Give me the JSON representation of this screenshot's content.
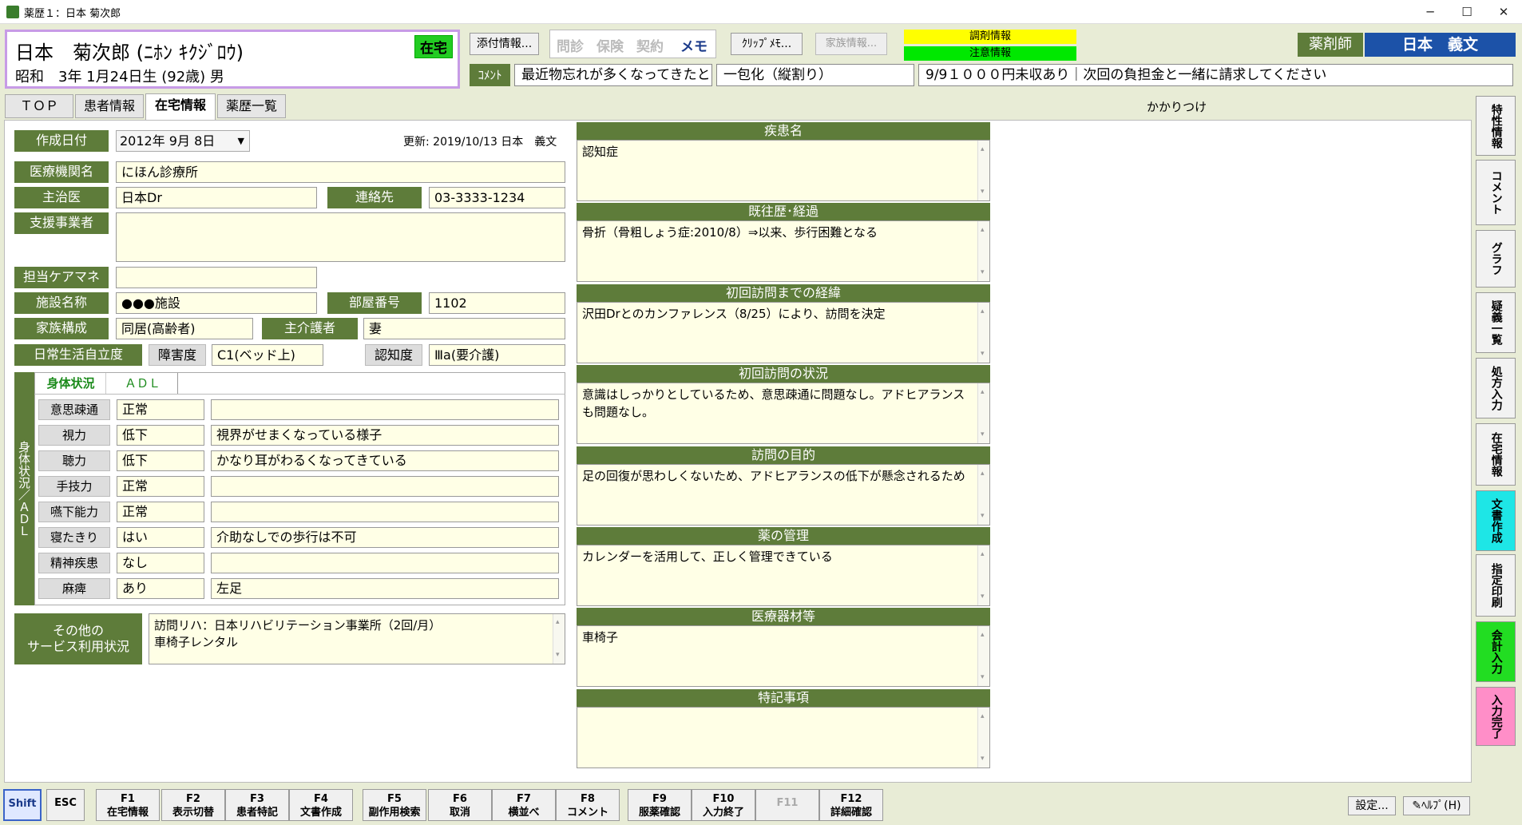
{
  "window": {
    "title": "薬歴１：日本 菊次郎",
    "minimize": "─",
    "maximize": "☐",
    "close": "✕"
  },
  "patient": {
    "name": "日本　菊次郎 (ﾆﾎﾝ ｷｸｼﾞﾛｳ)",
    "birth": "昭和　3年 1月24日生 (92歳) 男",
    "badge": "在宅"
  },
  "toolbar": {
    "attach": "添付情報...",
    "mon": "問診",
    "hoken": "保険",
    "keiyaku": "契約",
    "memo": "メモ",
    "clip": "ｸﾘｯﾌﾟﾒﾓ...",
    "family": "家族情報...",
    "chozai": "調剤情報",
    "chui": "注意情報",
    "role": "薬剤師",
    "pharmacist": "日本　義文",
    "comment_label": "ｺﾒﾝﾄ",
    "comment1": "最近物忘れが多くなってきたとの",
    "comment2": "一包化（縦割り）",
    "comment3": "9/9１０００円未収あり｜次回の負担金と一緒に請求してください"
  },
  "tabs": [
    "ＴＯＰ",
    "患者情報",
    "在宅情報",
    "薬歴一覧"
  ],
  "kakaritsuke": "かかりつけ",
  "form": {
    "created_label": "作成日付",
    "created": "2012年  9月  8日",
    "updated": "更新: 2019/10/13 日本　義文",
    "clinic_label": "医療機関名",
    "clinic": "にほん診療所",
    "doctor_label": "主治医",
    "doctor": "日本Dr",
    "contact_label": "連絡先",
    "contact": "03-3333-1234",
    "support_label": "支援事業者",
    "support": "",
    "caremgr_label": "担当ケアマネ",
    "caremgr": "",
    "facility_label": "施設名称",
    "facility": "●●●施設",
    "room_label": "部屋番号",
    "room": "1102",
    "family_label": "家族構成",
    "family": "同居(高齢者)",
    "caregiver_label": "主介護者",
    "caregiver": "妻",
    "adl_label": "日常生活自立度",
    "disability_label": "障害度",
    "disability": "C1(ベッド上)",
    "dementia_label": "認知度",
    "dementia": "Ⅲa(要介護)",
    "subtab1": "身体状況",
    "subtab2": "ＡＤＬ",
    "side_label": "身体状況／ＡＤＬ",
    "rows": [
      {
        "label": "意思疎通",
        "value": "正常",
        "note": ""
      },
      {
        "label": "視力",
        "value": "低下",
        "note": "視界がせまくなっている様子"
      },
      {
        "label": "聴力",
        "value": "低下",
        "note": "かなり耳がわるくなってきている"
      },
      {
        "label": "手技力",
        "value": "正常",
        "note": ""
      },
      {
        "label": "嚥下能力",
        "value": "正常",
        "note": ""
      },
      {
        "label": "寝たきり",
        "value": "はい",
        "note": "介助なしでの歩行は不可"
      },
      {
        "label": "精神疾患",
        "value": "なし",
        "note": ""
      },
      {
        "label": "麻痺",
        "value": "あり",
        "note": "左足"
      }
    ],
    "other_label1": "その他の",
    "other_label2": "サービス利用状況",
    "other1": "訪問リハ：日本リハビリテーション事業所（2回/月）",
    "other2": "車椅子レンタル"
  },
  "sections": [
    {
      "title": "疾患名",
      "body": "認知症"
    },
    {
      "title": "既往歴･経過",
      "body": "骨折（骨粗しょう症:2010/8）⇒以来、歩行困難となる"
    },
    {
      "title": "初回訪問までの経緯",
      "body": "沢田Drとのカンファレンス（8/25）により、訪問を決定"
    },
    {
      "title": "初回訪問の状況",
      "body": "意識はしっかりとしているため、意思疎通に問題なし。アドヒアランスも問題なし。"
    },
    {
      "title": "訪問の目的",
      "body": "足の回復が思わしくないため、アドヒアランスの低下が懸念されるため"
    },
    {
      "title": "薬の管理",
      "body": "カレンダーを活用して、正しく管理できている"
    },
    {
      "title": "医療器材等",
      "body": "車椅子"
    },
    {
      "title": "特記事項",
      "body": ""
    }
  ],
  "sidebar": [
    "特性情報",
    "コメント",
    "グラフ",
    "疑義一覧",
    "処方入力",
    "在宅情報",
    "文書作成",
    "指定印刷",
    "会計入力",
    "入力完了"
  ],
  "sidebar_colors": {
    "文書作成": "#1ee6e6",
    "会計入力": "#22dd22",
    "入力完了": "#ff8ec8"
  },
  "fkeys": [
    {
      "k": "Shift",
      "l": ""
    },
    {
      "k": "ESC",
      "l": ""
    },
    {
      "k": "F1",
      "l": "在宅情報"
    },
    {
      "k": "F2",
      "l": "表示切替"
    },
    {
      "k": "F3",
      "l": "患者特記"
    },
    {
      "k": "F4",
      "l": "文書作成"
    },
    {
      "k": "F5",
      "l": "副作用検索"
    },
    {
      "k": "F6",
      "l": "取消"
    },
    {
      "k": "F7",
      "l": "横並べ"
    },
    {
      "k": "F8",
      "l": "コメント"
    },
    {
      "k": "F9",
      "l": "服薬確認"
    },
    {
      "k": "F10",
      "l": "入力終了"
    },
    {
      "k": "F11",
      "l": ""
    },
    {
      "k": "F12",
      "l": "詳細確認"
    }
  ],
  "settings": "設定...",
  "help": "ﾍﾙﾌﾟ(H)"
}
